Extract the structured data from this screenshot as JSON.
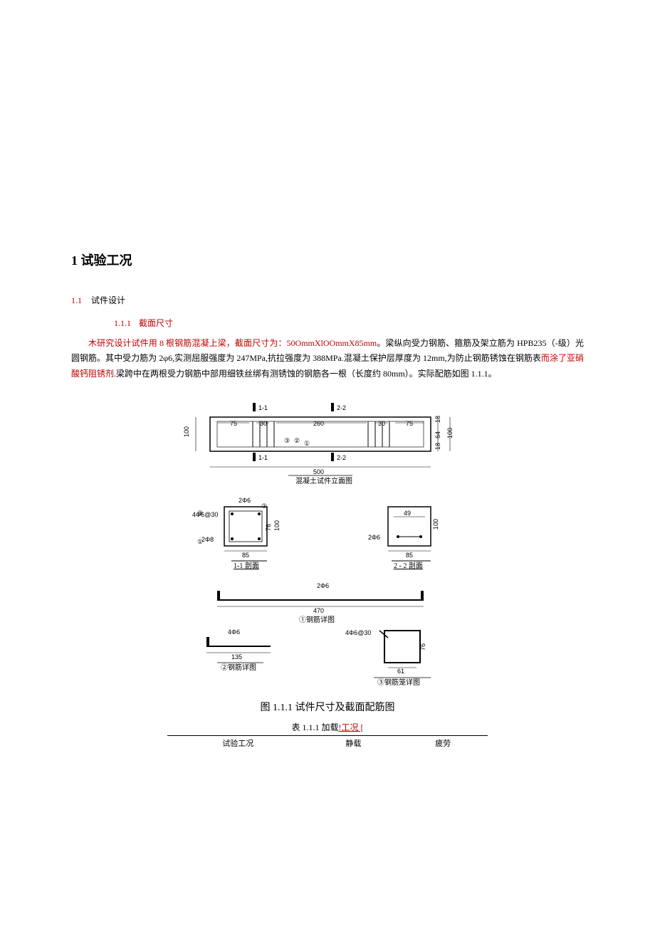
{
  "h1": "1 试验工况",
  "sec1": {
    "num": "1.1",
    "title": "试件设计"
  },
  "sec2": {
    "num": "1.1.1",
    "title": "截面尺寸"
  },
  "para": {
    "p1_red": "木研究设计试件用 8 根钢筋混凝上梁，截面尺寸为：50OmmXlOOmmX85mm",
    "p1_black": "。梁纵向受力钢筋、箍筋及架立筋为 HPB235（-级）光圆钢筋。其中受力筋为 2φ6,实测屈服强度为 247MPa,抗拉强度为 388MPa.混凝土保护层厚度为 12mm,为防止钢筋锈蚀在钢筋表",
    "p1_red2": "而涂了亚硝酸钙阻锈剂",
    "p1_black2": ".梁跨中在两根受力钢筋中部用细铁丝绑有测锈蚀的钢筋各一根（长度约 80mm）。实际配筋如图 1.1.1。"
  },
  "figure": {
    "top": {
      "d75a": "75",
      "d30a": "30",
      "d260": "260",
      "d30b": "30",
      "d75b": "75",
      "d500": "500",
      "h18a": "18",
      "h64": "64",
      "h18b": "18",
      "h100r": "100",
      "h100l": "100",
      "cut11": "1-1",
      "cut22": "2-2",
      "label": "混凝土试件立面图",
      "marks": {
        "c3": "③",
        "c2": "②",
        "c1": "①"
      }
    },
    "sec11": {
      "top": "2Φ6",
      "left4": "4Φ6@30",
      "bot": "2Φ8",
      "w": "85",
      "h76": "76",
      "h100": "100",
      "label": "1-1 剖面",
      "marks": {
        "c3": "③",
        "c2": "②",
        "c1": "①"
      }
    },
    "sec22": {
      "top": "2Φ6",
      "d49": "49",
      "w": "85",
      "h100": "100",
      "label": "2 - 2 剖面"
    },
    "det1": {
      "top": "2Φ6",
      "d470": "470",
      "label": "①钢筋详图"
    },
    "det2": {
      "top": "4Φ6",
      "d135": "135",
      "label": "②钢筋详图"
    },
    "det3": {
      "top": "4Φ6@30",
      "d61": "61",
      "h76": "76",
      "label": "③钢筋笼详图"
    },
    "caption": "图 1.1.1  试件尺寸及截面配筋图"
  },
  "table": {
    "caption_prefix": "表 1.1.1 加载",
    "caption_red": "!工况 [",
    "row": {
      "c1": "试验工况",
      "c2": "静载",
      "c3": "疲劳"
    }
  }
}
